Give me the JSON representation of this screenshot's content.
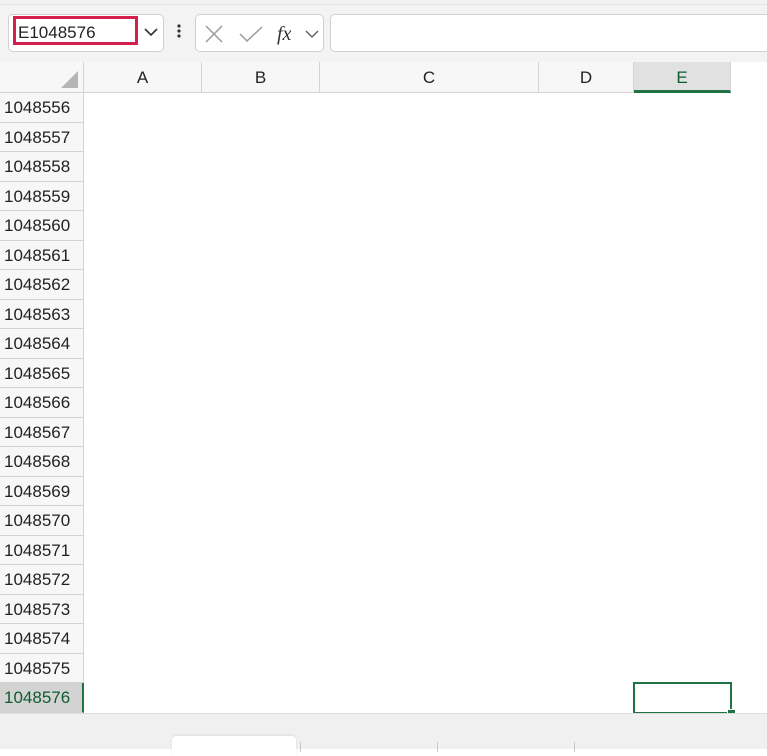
{
  "formula_bar": {
    "name_box_value": "E1048576",
    "formula_value": ""
  },
  "columns": [
    "A",
    "B",
    "C",
    "D",
    "E"
  ],
  "selected_column": "E",
  "rows": [
    "1048556",
    "1048557",
    "1048558",
    "1048559",
    "1048560",
    "1048561",
    "1048562",
    "1048563",
    "1048564",
    "1048565",
    "1048566",
    "1048567",
    "1048568",
    "1048569",
    "1048570",
    "1048571",
    "1048572",
    "1048573",
    "1048574",
    "1048575",
    "1048576"
  ],
  "selected_row": "1048576",
  "sheet_tabs": [
    {
      "label": "",
      "active": true
    }
  ],
  "colors": {
    "accent": "#217346",
    "name_box_highlight": "#d61f4e",
    "header_bg": "#f7f7f7"
  },
  "icons": {
    "name_box_dropdown": "chevron-down-icon",
    "more": "more-vertical-icon",
    "cancel": "close-icon",
    "enter": "check-icon",
    "function": "fx-icon",
    "function_dropdown": "chevron-down-icon",
    "select_all": "select-all-triangle-icon"
  }
}
